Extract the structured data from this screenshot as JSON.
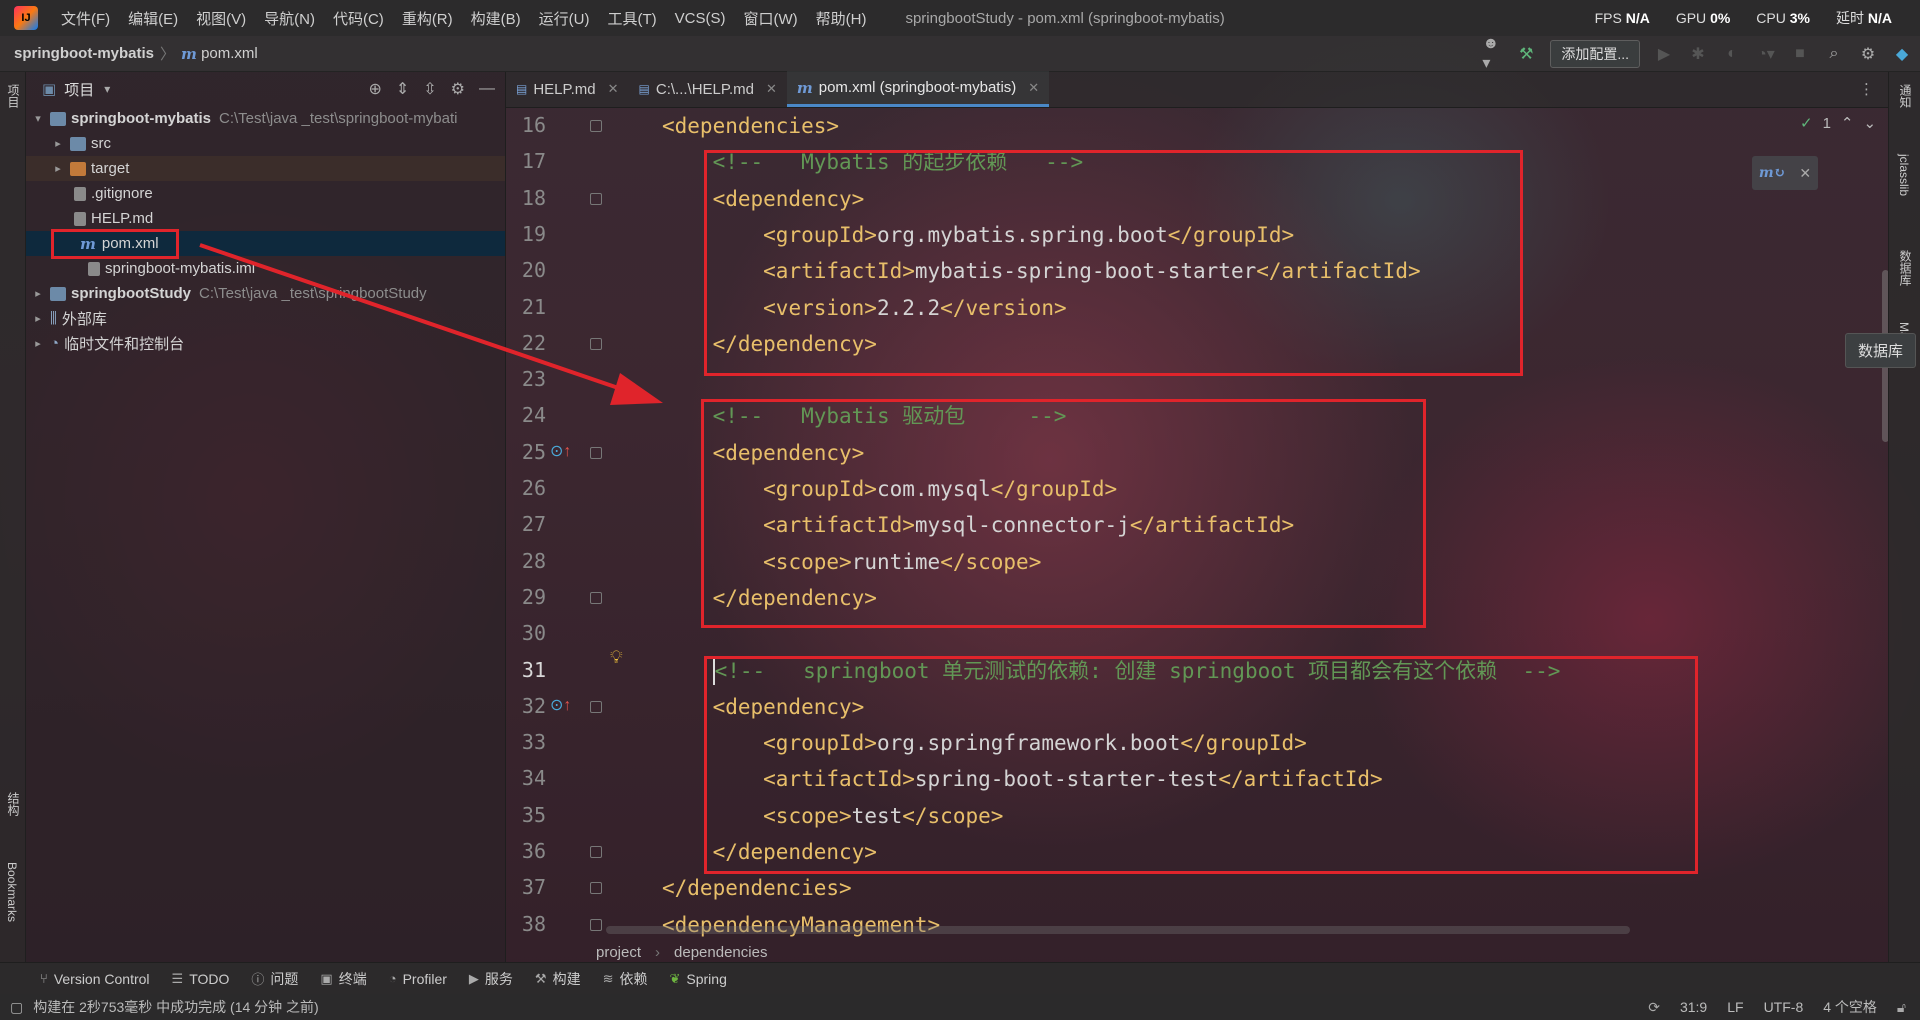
{
  "menubar": {
    "items": [
      "文件(F)",
      "编辑(E)",
      "视图(V)",
      "导航(N)",
      "代码(C)",
      "重构(R)",
      "构建(B)",
      "运行(U)",
      "工具(T)",
      "VCS(S)",
      "窗口(W)",
      "帮助(H)"
    ],
    "window_title": "springbootStudy - pom.xml (springboot-mybatis)",
    "perf": {
      "fps_label": "FPS",
      "fps_value": "N/A",
      "gpu_label": "GPU",
      "gpu_value": "0%",
      "cpu_label": "CPU",
      "cpu_value": "3%",
      "latency_label": "延时",
      "latency_value": "N/A"
    }
  },
  "navbar": {
    "project": "springboot-mybatis",
    "file": "pom.xml",
    "run_config": "添加配置..."
  },
  "left_stripe": {
    "project_label": "项目",
    "structure_label": "结构",
    "bookmarks_label": "Bookmarks"
  },
  "project_panel": {
    "title": "项目",
    "tree": [
      {
        "label": "springboot-mybatis",
        "path": "C:\\Test\\java _test\\springboot-mybati",
        "arrow": "▾"
      },
      {
        "label": "src",
        "arrow": "▸"
      },
      {
        "label": "target",
        "arrow": "▸"
      },
      {
        "label": ".gitignore"
      },
      {
        "label": "HELP.md"
      },
      {
        "label": "pom.xml"
      },
      {
        "label": "springboot-mybatis.iml"
      },
      {
        "label": "springbootStudy",
        "path": "C:\\Test\\java _test\\springbootStudy",
        "arrow": "▸"
      },
      {
        "label": "外部库",
        "arrow": "▸"
      },
      {
        "label": "临时文件和控制台",
        "arrow": "▸"
      }
    ]
  },
  "editor": {
    "tabs": [
      "HELP.md",
      "C:\\...\\HELP.md",
      "pom.xml (springboot-mybatis)"
    ],
    "inspection_count": "1",
    "lines": [
      {
        "no": "16",
        "indent": "",
        "parts": [
          [
            "tag",
            "<dependencies>"
          ]
        ]
      },
      {
        "no": "17",
        "indent": "    ",
        "parts": [
          [
            "cmt",
            "<!--   Mybatis 的起步依赖   -->"
          ]
        ]
      },
      {
        "no": "18",
        "indent": "    ",
        "parts": [
          [
            "tag",
            "<dependency>"
          ]
        ]
      },
      {
        "no": "19",
        "indent": "        ",
        "parts": [
          [
            "tag",
            "<groupId>"
          ],
          [
            "txt",
            "org.mybatis.spring.boot"
          ],
          [
            "tag",
            "</groupId>"
          ]
        ]
      },
      {
        "no": "20",
        "indent": "        ",
        "parts": [
          [
            "tag",
            "<artifactId>"
          ],
          [
            "txt",
            "mybatis-spring-boot-starter"
          ],
          [
            "tag",
            "</artifactId>"
          ]
        ]
      },
      {
        "no": "21",
        "indent": "        ",
        "parts": [
          [
            "tag",
            "<version>"
          ],
          [
            "txt",
            "2.2.2"
          ],
          [
            "tag",
            "</version>"
          ]
        ]
      },
      {
        "no": "22",
        "indent": "    ",
        "parts": [
          [
            "tag",
            "</dependency>"
          ]
        ]
      },
      {
        "no": "23",
        "indent": "",
        "parts": []
      },
      {
        "no": "24",
        "indent": "    ",
        "parts": [
          [
            "cmt",
            "<!--   Mybatis 驱动包     -->"
          ]
        ]
      },
      {
        "no": "25",
        "indent": "    ",
        "parts": [
          [
            "tag",
            "<dependency>"
          ]
        ]
      },
      {
        "no": "26",
        "indent": "        ",
        "parts": [
          [
            "tag",
            "<groupId>"
          ],
          [
            "txt",
            "com.mysql"
          ],
          [
            "tag",
            "</groupId>"
          ]
        ]
      },
      {
        "no": "27",
        "indent": "        ",
        "parts": [
          [
            "tag",
            "<artifactId>"
          ],
          [
            "txt",
            "mysql-connector-j"
          ],
          [
            "tag",
            "</artifactId>"
          ]
        ]
      },
      {
        "no": "28",
        "indent": "        ",
        "parts": [
          [
            "tag",
            "<scope>"
          ],
          [
            "txt",
            "runtime"
          ],
          [
            "tag",
            "</scope>"
          ]
        ]
      },
      {
        "no": "29",
        "indent": "    ",
        "parts": [
          [
            "tag",
            "</dependency>"
          ]
        ]
      },
      {
        "no": "30",
        "indent": "",
        "parts": []
      },
      {
        "no": "31",
        "indent": "    ",
        "parts": [
          [
            "cmt",
            "<!--   springboot 单元测试的依赖: 创建 springboot 项目都会有这个依赖  -->"
          ]
        ]
      },
      {
        "no": "32",
        "indent": "    ",
        "parts": [
          [
            "tag",
            "<dependency>"
          ]
        ]
      },
      {
        "no": "33",
        "indent": "        ",
        "parts": [
          [
            "tag",
            "<groupId>"
          ],
          [
            "txt",
            "org.springframework.boot"
          ],
          [
            "tag",
            "</groupId>"
          ]
        ]
      },
      {
        "no": "34",
        "indent": "        ",
        "parts": [
          [
            "tag",
            "<artifactId>"
          ],
          [
            "txt",
            "spring-boot-starter-test"
          ],
          [
            "tag",
            "</artifactId>"
          ]
        ]
      },
      {
        "no": "35",
        "indent": "        ",
        "parts": [
          [
            "tag",
            "<scope>"
          ],
          [
            "txt",
            "test"
          ],
          [
            "tag",
            "</scope>"
          ]
        ]
      },
      {
        "no": "36",
        "indent": "    ",
        "parts": [
          [
            "tag",
            "</dependency>"
          ]
        ]
      },
      {
        "no": "37",
        "indent": "",
        "parts": [
          [
            "tag",
            "</dependencies>"
          ]
        ]
      },
      {
        "no": "38",
        "indent": "",
        "parts": [
          [
            "tag",
            "<dependencyManagement>"
          ]
        ]
      }
    ],
    "current_line": "31",
    "breadcrumbs": [
      "project",
      "dependencies"
    ]
  },
  "right_stripe": {
    "notifications": "通知",
    "jclasslib": "jclasslib",
    "database": "数据库",
    "maven": "Maven"
  },
  "db_tooltip": "数据库",
  "bottom_toolbar": [
    "Version Control",
    "TODO",
    "问题",
    "终端",
    "Profiler",
    "服务",
    "构建",
    "依赖",
    "Spring"
  ],
  "status": {
    "message": "构建在 2秒753毫秒 中成功完成 (14 分钟 之前)",
    "position": "31:9",
    "line_sep": "LF",
    "encoding": "UTF-8",
    "indent": "4 个空格"
  },
  "colors": {
    "highlight_red": "#e0242b",
    "tag": "#e8bf6a",
    "comment": "#629755",
    "selection": "#0d293e"
  }
}
